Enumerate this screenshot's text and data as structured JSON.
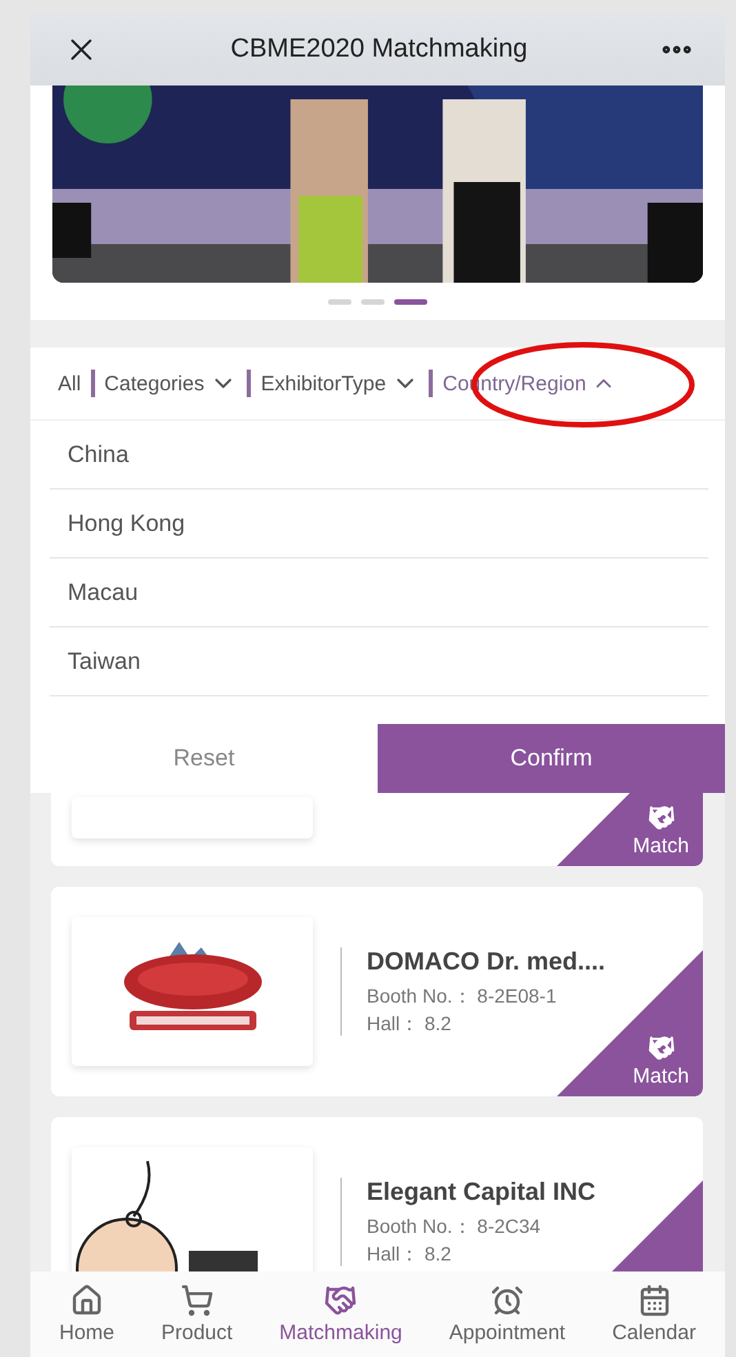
{
  "header": {
    "title": "CBME2020 Matchmaking"
  },
  "banner": {
    "dots": [
      {
        "selected": false
      },
      {
        "selected": false
      },
      {
        "selected": true
      }
    ]
  },
  "filters": [
    {
      "label": "All",
      "kind": "plain",
      "selected": false
    },
    {
      "label": "Categories",
      "kind": "menu",
      "selected": false
    },
    {
      "label": "ExhibitorType",
      "kind": "menu",
      "selected": false
    },
    {
      "label": "Country/Region",
      "kind": "menu",
      "selected": true
    }
  ],
  "dropdown": {
    "options": [
      {
        "label": "China"
      },
      {
        "label": "Hong Kong"
      },
      {
        "label": "Macau"
      },
      {
        "label": "Taiwan"
      }
    ],
    "reset": "Reset",
    "confirm": "Confirm"
  },
  "exhibitors": [
    {
      "kind": "partial",
      "match": "Match"
    },
    {
      "kind": "full",
      "name": "DOMACO Dr. med....",
      "booth": "Booth No.：  8-2E08-1",
      "hall": "Hall：  8.2",
      "match": "Match"
    },
    {
      "kind": "full",
      "name": "Elegant Capital INC",
      "booth": "Booth No.：  8-2C34",
      "hall": "Hall：  8.2"
    }
  ],
  "tabs": [
    {
      "label": "Home",
      "selected": false
    },
    {
      "label": "Product",
      "selected": false
    },
    {
      "label": "Matchmaking",
      "selected": true
    },
    {
      "label": "Appointment",
      "selected": false
    },
    {
      "label": "Calendar",
      "selected": false
    }
  ]
}
